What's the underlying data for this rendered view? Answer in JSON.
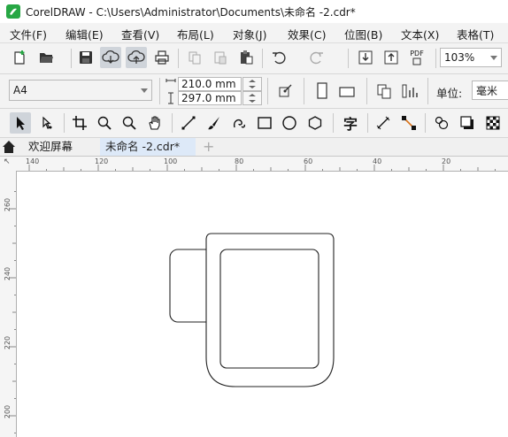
{
  "window": {
    "title": "CorelDRAW - C:\\Users\\Administrator\\Documents\\未命名 -2.cdr*",
    "accent_color": "#27a744"
  },
  "menu": {
    "items": [
      "文件(F)",
      "编辑(E)",
      "查看(V)",
      "布局(L)",
      "对象(J)",
      "效果(C)",
      "位图(B)",
      "文本(X)",
      "表格(T)"
    ]
  },
  "toolbar": {
    "zoom_level": "103%",
    "icons": [
      "new-document-icon",
      "open-folder-icon",
      "save-icon",
      "cloud-download-icon",
      "cloud-upload-icon",
      "print-icon",
      "copy-icon",
      "paste-icon",
      "clipboard-icon",
      "undo-icon",
      "redo-icon",
      "import-icon",
      "export-icon",
      "pdf-icon"
    ],
    "pdf_label": "PDF"
  },
  "property_bar": {
    "page_size": "A4",
    "width": "210.0 mm",
    "height": "297.0 mm",
    "units_label": "单位:",
    "units_value": "毫米"
  },
  "tools": [
    "pick-tool-icon",
    "shape-tool-icon",
    "crop-tool-icon",
    "zoom-tool-icon",
    "zoom-out-icon",
    "pan-tool-icon",
    "freehand-tool-icon",
    "artistic-media-icon",
    "spiral-icon",
    "rectangle-tool-icon",
    "ellipse-tool-icon",
    "polygon-tool-icon",
    "text-tool-icon",
    "dimension-tool-icon",
    "connector-tool-icon",
    "effects-tool-icon",
    "shadow-tool-icon",
    "transparency-tool-icon"
  ],
  "text_tool_glyph": "字",
  "tabs": {
    "home_icon": "home-icon",
    "welcome": "欢迎屏幕",
    "document": "未命名 -2.cdr*",
    "add": "+"
  },
  "rulers": {
    "horizontal": [
      "140",
      "120",
      "100",
      "80",
      "60",
      "40",
      "20"
    ],
    "vertical": [
      "260",
      "240",
      "220",
      "200"
    ],
    "corner_glyph": "↖"
  }
}
